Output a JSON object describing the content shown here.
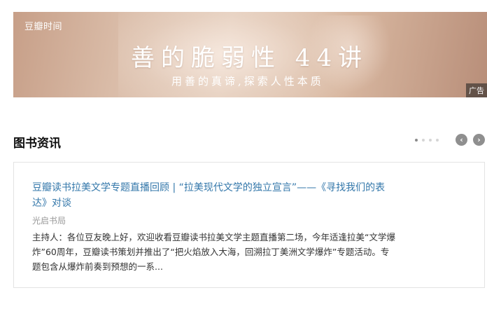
{
  "banner": {
    "logo": "豆瓣时间",
    "title": "善的脆弱性 44讲",
    "subtitle": "用善的真谛,探索人性本质",
    "ad_label": "广告"
  },
  "section": {
    "title": "图书资讯",
    "carousel": {
      "pages": 4,
      "active_index": 0
    }
  },
  "card": {
    "headline": "豆瓣读书拉美文学专题直播回顾 | “拉美现代文学的独立宣言”——《寻找我们的表达》对谈",
    "source": "光启书局",
    "summary": "主持人：各位豆友晚上好，欢迎收看豆瓣读书拉美文学主题直播第二场，今年适逢拉美“文学爆炸”60周年，豆瓣读书策划并推出了“把火焰放入大海，回溯拉丁美洲文学爆炸”专题活动。专题包含从爆炸前奏到预想的一系..."
  },
  "icons": {
    "prev": "chevron-left-icon",
    "next": "chevron-right-icon"
  },
  "colors": {
    "link": "#3377aa",
    "banner_tone": "#d9bba7"
  }
}
